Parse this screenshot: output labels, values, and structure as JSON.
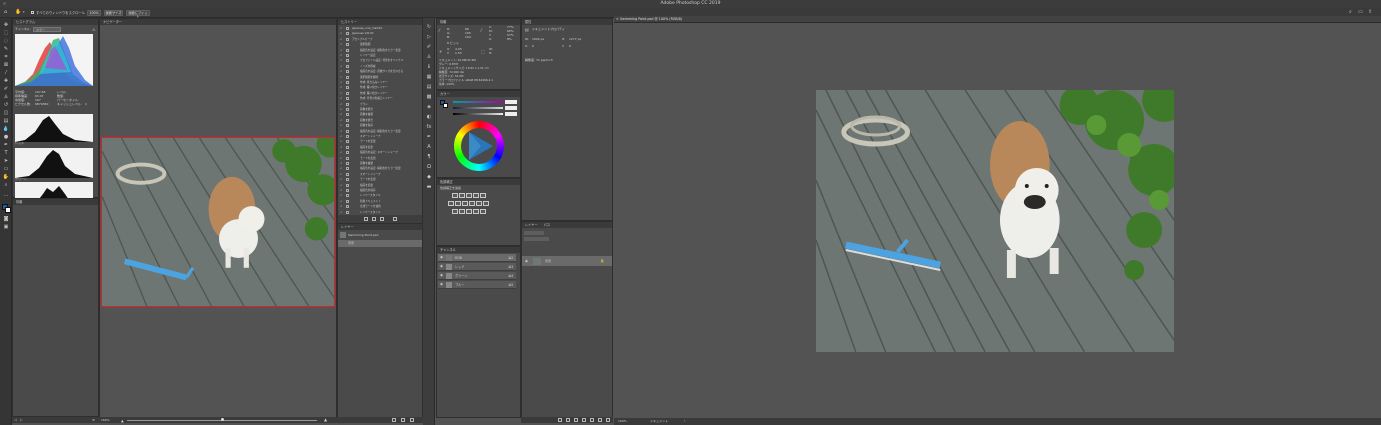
{
  "window": {
    "title": "Adobe Photoshop CC 2019"
  },
  "options_bar": {
    "scroll_all_label": "すべてのウィンドウをスクロール",
    "zoom_100": "100%",
    "fit_screen": "画面サイズ",
    "fill_screen": "画面にフィット"
  },
  "panels": {
    "histogram": {
      "title": "ヒストグラム",
      "channel_label": "チャンネル:",
      "channel_value": "カラー",
      "stats": [
        "平均値:",
        "標準偏差:",
        "中間値:",
        "ピクセル数:",
        "レベル:",
        "数値:",
        "パーセンタイル:",
        "キャッシュレベル:"
      ],
      "stat_values": [
        "107.65",
        "63.47",
        "107",
        "6879360",
        "",
        "",
        "",
        "1"
      ],
      "sub_labels": [
        "レッド",
        "グリーン",
        "ブルー"
      ]
    },
    "info": {
      "title": "情報"
    },
    "navigator": {
      "title": "ナビゲーター",
      "zoom": "166%"
    },
    "history": {
      "title": "ヒストリー",
      "items": [
        "Japanese_crop_mark01",
        "Japanese wht 02",
        "アセンブルカーブ",
        "選択範囲",
        "描画色を設定: 補助色をカラー変更",
        "レイヤー設定",
        "プロファイル設定: 背景をオリジナル",
        "ノイズを軽減",
        "描画色を設定: 画像サイズを合わせる",
        "選択範囲を解除",
        "作成: 焼き込みレイヤー",
        "作成: 覆い焼きレイヤー",
        "作成: 覆い焼きレイヤー",
        "作成: 背景の色補正レイヤー",
        "ブラシ",
        "画像を統合",
        "画像を複製",
        "画像を統合",
        "画像を保存",
        "描画色を設定: 補助色をカラー変更",
        "スマートシャープ",
        "モードを変更",
        "描画を変更",
        "描画色を設定: スマートシャープ",
        "モードを変更",
        "画像を複製",
        "描画色を設定: 補助色をカラー変更",
        "スマートシャープ",
        "モードを変更",
        "描画を変更",
        "描画色を保存",
        "レイヤースタイル",
        "新規ドキュメント",
        "合成モードを適用",
        "レイヤースタイル"
      ]
    },
    "layers_mini": {
      "title": "レイヤー",
      "doc": "Swimming Point.psd",
      "layer": "背景"
    },
    "info2": {
      "title": "情報",
      "rgb": [
        "R:",
        "G:",
        "B:"
      ],
      "rgb_vals": [
        "66",
        "105",
        "104"
      ],
      "cmyk": [
        "C:",
        "M:",
        "Y:",
        "K:"
      ],
      "cmyk_vals": [
        "77%",
        "60%",
        "57%",
        "8%"
      ],
      "bits": "8 ビット",
      "xy": [
        "X:",
        "Y:"
      ],
      "xy_vals": [
        "4.03",
        "1.53"
      ],
      "wh": [
        "W:",
        "H:"
      ],
      "doc_lines": [
        "ドキュメント: 32.9M/32.9M",
        "グレー: 6.87M",
        "ドキュメントサイズ: 15.63 x 1.31 cm",
        "解像度: 72.000 dpi",
        "表示サイズ: 32.9M",
        "カラープロファイル: sRGB IEC61966-2.1",
        "効率: 100%"
      ]
    },
    "color": {
      "title": "カラー"
    },
    "adjustments": {
      "title": "色調補正",
      "subtitle": "色調補正を追加"
    },
    "channels": {
      "title": "チャンネル",
      "rows": [
        {
          "name": "RGB",
          "key": "⌘2"
        },
        {
          "name": "レッド",
          "key": "⌘3"
        },
        {
          "name": "グリーン",
          "key": "⌘4"
        },
        {
          "name": "ブルー",
          "key": "⌘5"
        }
      ]
    },
    "properties": {
      "title": "属性",
      "doc_label": "ドキュメントプロパティ",
      "w_label": "W:",
      "w_val": "1920 px",
      "h_label": "H:",
      "h_val": "1277 px",
      "x_label": "X:",
      "x_val": "0",
      "y_label": "Y:",
      "y_val": "0",
      "res": "解像度: 72 ppi/inch"
    },
    "layers": {
      "title": "レイヤー",
      "tab2": "パス",
      "layer_name": "背景"
    }
  },
  "document": {
    "tab": "Swimming Point.psd @ 100% (RGB/8)",
    "zoom": "100%",
    "status": "ドキュメント"
  },
  "colors": {
    "app_bg": "#535353",
    "panel_bg": "#4a4a4a",
    "accent_red": "#e02020",
    "swatch_fg": "#1e5ca8",
    "swatch_bg": "#ffffff"
  }
}
